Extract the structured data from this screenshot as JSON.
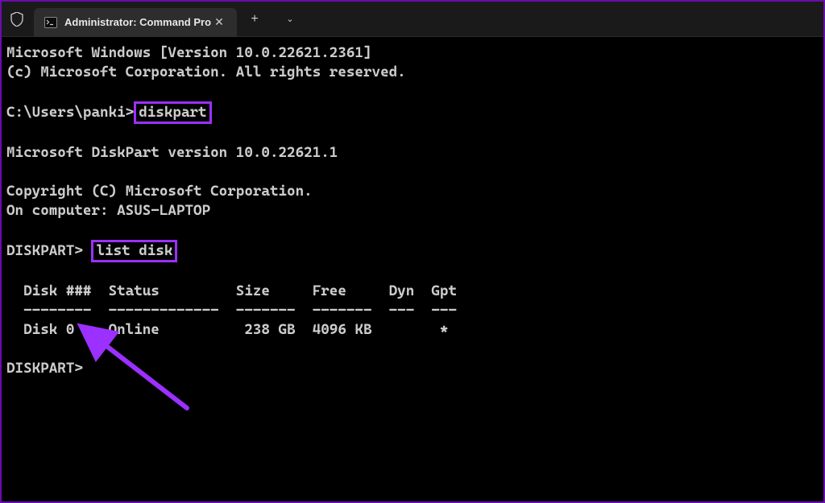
{
  "titlebar": {
    "tab_title": "Administrator: Command Pro"
  },
  "terminal": {
    "line1": "Microsoft Windows [Version 10.0.22621.2361]",
    "line2": "(c) Microsoft Corporation. All rights reserved.",
    "prompt1_prefix": "C:\\Users\\panki>",
    "prompt1_cmd": "diskpart",
    "line5": "Microsoft DiskPart version 10.0.22621.1",
    "line7": "Copyright (C) Microsoft Corporation.",
    "line8": "On computer: ASUS-LAPTOP",
    "prompt2_prefix": "DISKPART> ",
    "prompt2_cmd": "list disk",
    "table_header": "  Disk ###  Status         Size     Free     Dyn  Gpt",
    "table_divider": "  --------  -------------  -------  -------  ---  ---",
    "table_row1": "  Disk 0    Online          238 GB  4096 KB        *",
    "prompt3": "DISKPART>"
  },
  "colors": {
    "highlight_border": "#9b30ff",
    "arrow": "#9b30ff"
  }
}
